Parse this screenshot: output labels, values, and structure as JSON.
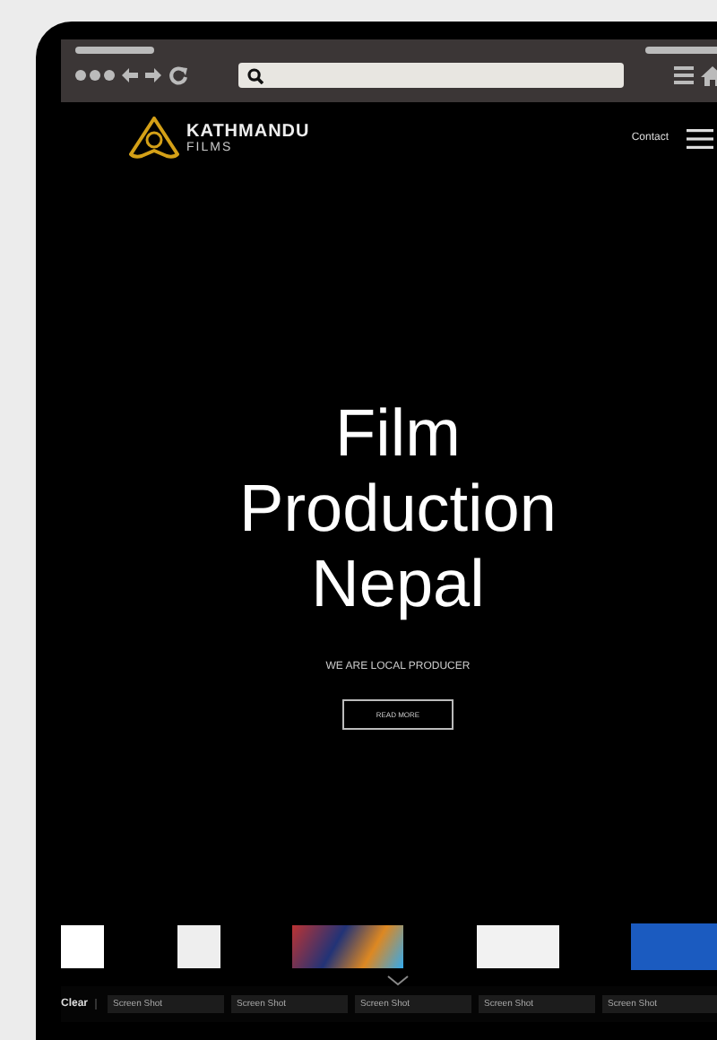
{
  "site": {
    "brand": "KATHMANDU",
    "brand_sub": "FILMS",
    "nav_link": "Contact"
  },
  "hero": {
    "title_lines": [
      "Film",
      "Production",
      "Nepal"
    ],
    "subtitle": "WE ARE LOCAL PRODUCER",
    "button": "READ MORE"
  },
  "dock": {
    "clear": "Clear",
    "thumbnails": [
      "Screen Shot",
      "Screen Shot",
      "Screen Shot",
      "Screen Shot",
      "Screen Shot"
    ]
  }
}
